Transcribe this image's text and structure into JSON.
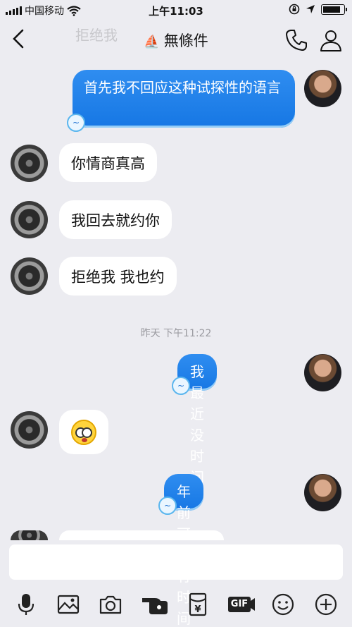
{
  "status_bar": {
    "carrier": "中国移动",
    "time": "上午11:03",
    "battery_level": 0.9
  },
  "nav": {
    "faded_title": "拒绝我",
    "title": "無條件",
    "title_emoji": "⛵"
  },
  "messages": [
    {
      "from": "me",
      "text": "首先我不回应这种试探性的语言"
    },
    {
      "from": "them",
      "text": "你情商真高"
    },
    {
      "from": "them",
      "text": "我回去就约你"
    },
    {
      "from": "them",
      "text": "拒绝我 我也约"
    },
    {
      "from": "me",
      "text": "我最近没时间"
    },
    {
      "from": "them",
      "emoji": "shocked-face"
    },
    {
      "from": "me",
      "text": "年前可能有时间"
    }
  ],
  "timestamp": "昨天 下午11:22",
  "input": {
    "placeholder": ""
  },
  "toolbar": {
    "gif_label": "GIF",
    "items": [
      "microphone-icon",
      "image-icon",
      "camera-icon",
      "hand-icon",
      "red-packet-icon",
      "gif-icon",
      "emoji-icon",
      "plus-icon"
    ]
  },
  "colors": {
    "background": "#ececf1",
    "bubble_me": "#1f80ea",
    "bubble_them": "#ffffff"
  }
}
